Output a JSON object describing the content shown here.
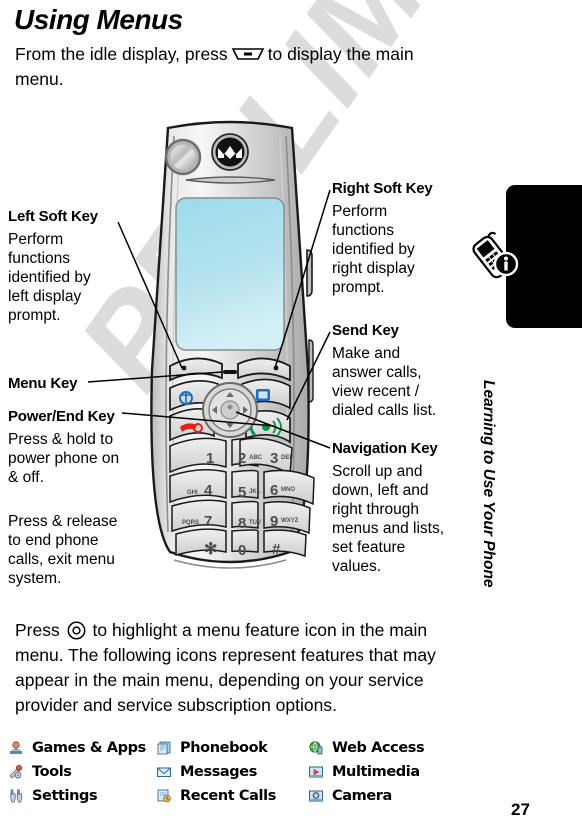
{
  "document": {
    "title": "Using Menus",
    "watermark": "PRELIMINARY",
    "page_number": "27",
    "side_tab_title": "Learning to Use Your Phone"
  },
  "intro": {
    "before_glyph": "From the idle display, press",
    "glyph": "soft-key-glyph",
    "after_glyph": "to display the main menu."
  },
  "figure": {
    "callouts": [
      {
        "id": "left-soft-key",
        "heading": "Left Soft Key",
        "body": "Perform functions identified by left display prompt."
      },
      {
        "id": "menu-key",
        "heading": "Menu Key",
        "body": ""
      },
      {
        "id": "power-end-key",
        "heading": "Power/End Key",
        "body_1": "Press & hold to power phone on & off.",
        "body_2": "Press & release to end phone calls, exit menu system."
      },
      {
        "id": "right-soft-key",
        "heading": "Right Soft Key",
        "body": "Perform functions identified by right display prompt."
      },
      {
        "id": "send-key",
        "heading": "Send Key",
        "body": "Make and answer calls, view recent / dialed calls list."
      },
      {
        "id": "navigation-key",
        "heading": "Navigation Key",
        "body": "Scroll up and down, left and right through menus and lists, set feature values."
      }
    ],
    "phone": {
      "brand_logo": "motorola-m-logo",
      "keypad": [
        {
          "digit": "1",
          "letters": ""
        },
        {
          "digit": "2",
          "letters": "ABC"
        },
        {
          "digit": "3",
          "letters": "DEF"
        },
        {
          "digit": "4",
          "letters": "GHI"
        },
        {
          "digit": "5",
          "letters": "JKL"
        },
        {
          "digit": "6",
          "letters": "MNO"
        },
        {
          "digit": "7",
          "letters": "PQRS"
        },
        {
          "digit": "8",
          "letters": "TUV"
        },
        {
          "digit": "9",
          "letters": "WXYZ"
        },
        {
          "digit": "*",
          "letters": ""
        },
        {
          "digit": "0",
          "letters": ""
        },
        {
          "digit": "#",
          "letters": ""
        }
      ],
      "colors": {
        "display": "#a8dcea",
        "body_light": "#e6e6e6",
        "body_mid": "#c9c9c9",
        "send_green": "#009944",
        "end_red": "#e2211c",
        "soft_blue": "#1a6fc4"
      }
    }
  },
  "press_paragraph": {
    "before_glyph": "Press",
    "glyph": "navigation-key-glyph",
    "after_glyph": "to highlight a menu feature icon in the main menu. The following icons represent features that may appear in the main menu, depending on your service provider and service subscription options."
  },
  "menu_icons": [
    {
      "icon": "games-and-apps-icon",
      "label": "Games & Apps"
    },
    {
      "icon": "phonebook-icon",
      "label": "Phonebook"
    },
    {
      "icon": "web-access-icon",
      "label": "Web Access"
    },
    {
      "icon": "tools-icon",
      "label": "Tools"
    },
    {
      "icon": "messages-icon",
      "label": "Messages"
    },
    {
      "icon": "multimedia-icon",
      "label": "Multimedia"
    },
    {
      "icon": "settings-icon",
      "label": "Settings"
    },
    {
      "icon": "recent-calls-icon",
      "label": "Recent Calls"
    },
    {
      "icon": "camera-icon",
      "label": "Camera"
    }
  ]
}
